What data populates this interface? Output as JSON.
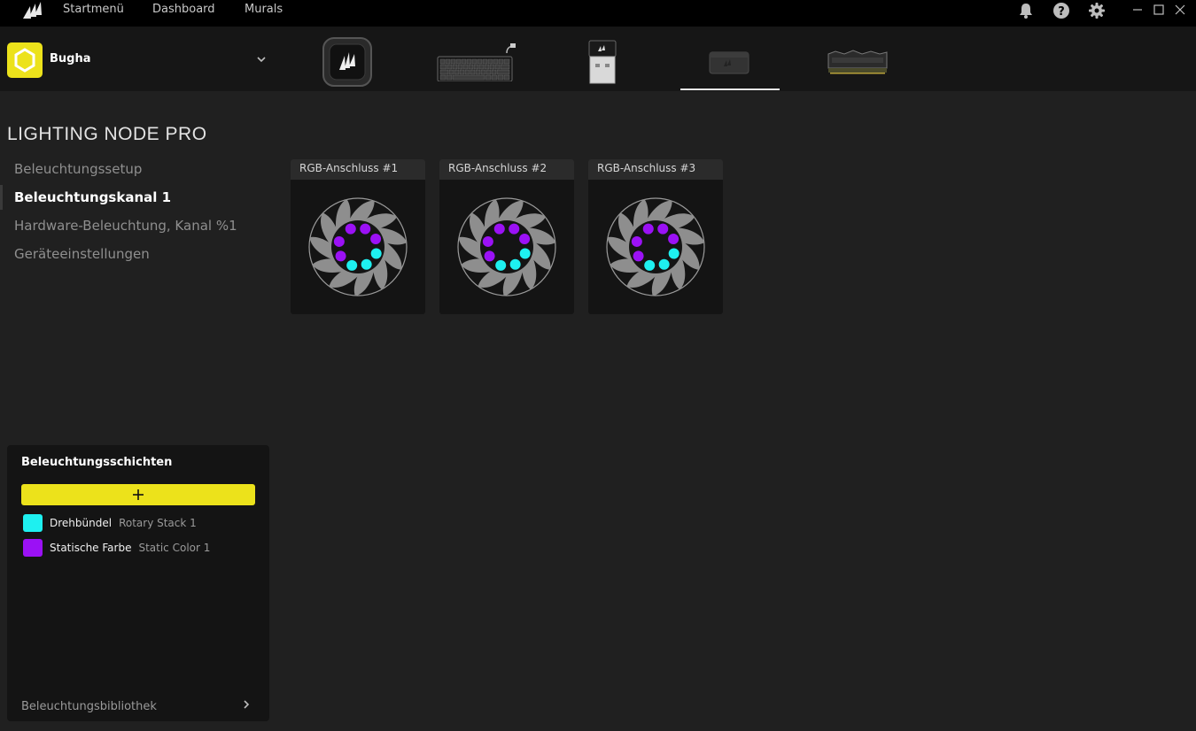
{
  "topbar": {
    "nav": [
      "Startmenü",
      "Dashboard",
      "Murals"
    ],
    "icons": [
      "bell-icon",
      "help-icon",
      "gear-icon"
    ],
    "window_controls": [
      "minimize-icon",
      "maximize-icon",
      "close-icon"
    ]
  },
  "profile": {
    "name": "Bugha",
    "icon": "hexagon-icon"
  },
  "devices": [
    "cooler-pump",
    "keyboard",
    "usb-dongle",
    "lighting-node-pro",
    "ram-module"
  ],
  "selected_device": "lighting-node-pro",
  "page": {
    "title": "LIGHTING NODE PRO"
  },
  "sidenav": {
    "items": [
      "Beleuchtungssetup",
      "Beleuchtungskanal 1",
      "Hardware-Beleuchtung, Kanal %1",
      "Geräteeinstellungen"
    ],
    "active": "Beleuchtungskanal 1"
  },
  "channels": [
    {
      "label": "RGB-Anschluss #1"
    },
    {
      "label": "RGB-Anschluss #2"
    },
    {
      "label": "RGB-Anschluss #3"
    }
  ],
  "layers": {
    "title": "Beleuchtungsschichten",
    "add_icon": "plus-icon",
    "items": [
      {
        "name": "Drehbündel",
        "sub": "Rotary Stack 1",
        "color": "#1ef0f0"
      },
      {
        "name": "Statische Farbe",
        "sub": "Static Color 1",
        "color": "#9b11f5"
      }
    ],
    "library": "Beleuchtungsbibliothek"
  },
  "colors": {
    "accent": "#ece21b",
    "cyan": "#1ef0f0",
    "purple": "#9b11f5"
  }
}
